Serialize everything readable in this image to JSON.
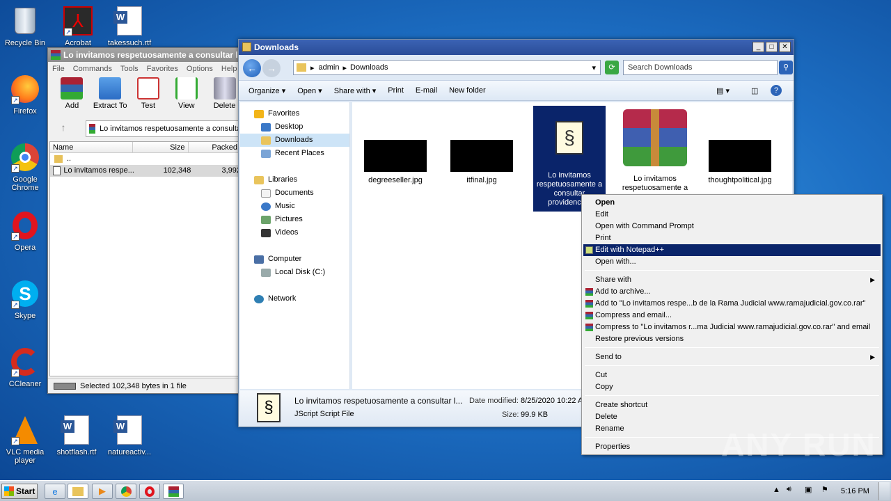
{
  "desktop": {
    "icons_left": [
      {
        "label": "Recycle Bin",
        "icon": "recycle-bin-icon"
      },
      {
        "label": "Firefox",
        "icon": "firefox-icon"
      },
      {
        "label": "Google Chrome",
        "icon": "chrome-icon"
      },
      {
        "label": "Opera",
        "icon": "opera-icon"
      },
      {
        "label": "Skype",
        "icon": "skype-icon"
      },
      {
        "label": "CCleaner",
        "icon": "ccleaner-icon"
      },
      {
        "label": "VLC media player",
        "icon": "vlc-icon"
      }
    ],
    "icons_top": [
      {
        "label": "Acrobat",
        "icon": "acrobat-icon"
      },
      {
        "label": "takessuch.rtf",
        "icon": "word-doc-icon"
      }
    ],
    "icons_bottom": [
      {
        "label": "shotflash.rtf",
        "icon": "word-doc-icon"
      },
      {
        "label": "natureactiv...",
        "icon": "word-doc-icon"
      }
    ]
  },
  "winrar": {
    "title": "Lo invitamos respetuosamente a consultar la",
    "menu": [
      "File",
      "Commands",
      "Tools",
      "Favorites",
      "Options",
      "Help"
    ],
    "tools": [
      "Add",
      "Extract To",
      "Test",
      "View",
      "Delete"
    ],
    "path": "Lo invitamos respetuosamente a consulta",
    "columns": [
      "Name",
      "Size",
      "Packed"
    ],
    "rows": [
      {
        "name": "..",
        "size": "",
        "packed": ""
      },
      {
        "name": "Lo invitamos respe...",
        "size": "102,348",
        "packed": "3,992"
      }
    ],
    "status": "Selected 102,348 bytes in 1 file"
  },
  "explorer": {
    "title": "Downloads",
    "breadcrumb": [
      "admin",
      "Downloads"
    ],
    "search_placeholder": "Search Downloads",
    "commands": [
      "Organize ▾",
      "Open ▾",
      "Share with ▾",
      "Print",
      "E-mail",
      "New folder"
    ],
    "nav": {
      "favorites": "Favorites",
      "desktop": "Desktop",
      "downloads": "Downloads",
      "recent": "Recent Places",
      "libraries": "Libraries",
      "documents": "Documents",
      "music": "Music",
      "pictures": "Pictures",
      "videos": "Videos",
      "computer": "Computer",
      "localdisk": "Local Disk (C:)",
      "network": "Network"
    },
    "files": [
      {
        "name": "degreeseller.jpg"
      },
      {
        "name": "itfinal.jpg"
      },
      {
        "name": "Lo invitamos respetuosamente a consultar providencias"
      },
      {
        "name": "Lo invitamos respetuosamente a"
      },
      {
        "name": "thoughtpolitical.jpg"
      }
    ],
    "details": {
      "name": "Lo invitamos respetuosamente a consultar l...",
      "type": "JScript Script File",
      "modified_label": "Date modified:",
      "modified": "8/25/2020 10:22 A",
      "size_label": "Size:",
      "size": "99.9 KB"
    }
  },
  "context_menu": {
    "open": "Open",
    "edit": "Edit",
    "open_cmd": "Open with Command Prompt",
    "print": "Print",
    "edit_npp": "Edit with Notepad++",
    "open_with": "Open with...",
    "share_with": "Share with",
    "add_archive": "Add to archive...",
    "add_rar": "Add to \"Lo invitamos respe...b de la Rama Judicial www.ramajudicial.gov.co.rar\"",
    "compress_email": "Compress and email...",
    "compress_rar_email": "Compress to \"Lo invitamos r...ma Judicial www.ramajudicial.gov.co.rar\" and email",
    "restore": "Restore previous versions",
    "send_to": "Send to",
    "cut": "Cut",
    "copy": "Copy",
    "create_shortcut": "Create shortcut",
    "delete": "Delete",
    "rename": "Rename",
    "properties": "Properties"
  },
  "taskbar": {
    "start": "Start",
    "clock": "5:16 PM"
  },
  "watermark": "ANY RUN"
}
